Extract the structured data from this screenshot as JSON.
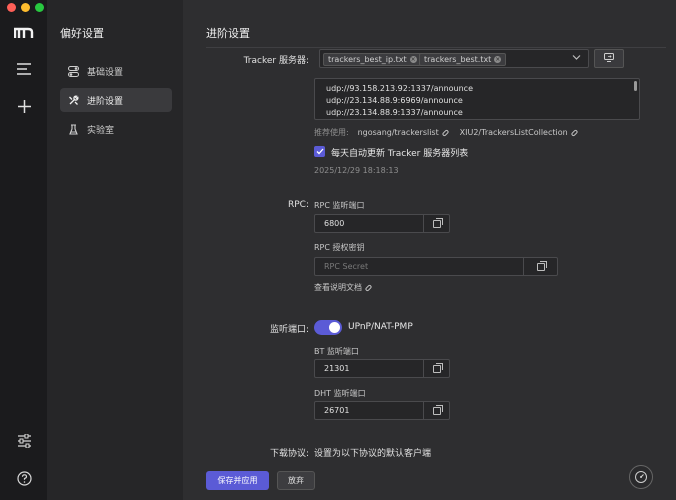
{
  "colors": {
    "accent": "#5b5bd6",
    "rail_bg": "#1b1b1d",
    "sidebar_bg": "#262628",
    "main_bg": "#2e2e30"
  },
  "rail": {
    "logo_icon": "m-logo-icon",
    "top_icons": [
      "menu-lines-icon",
      "plus-icon"
    ],
    "bottom_icons": [
      "sliders-icon",
      "help-circle-icon"
    ]
  },
  "sidebar": {
    "title": "偏好设置",
    "items": [
      {
        "label": "基础设置",
        "icon": "toggle-icon",
        "active": false
      },
      {
        "label": "进阶设置",
        "icon": "wrench-icon",
        "active": true
      },
      {
        "label": "实验室",
        "icon": "flask-icon",
        "active": false
      }
    ]
  },
  "main": {
    "title": "进阶设置",
    "tracker": {
      "label": "Tracker 服务器:",
      "selected": [
        "trackers_best_ip.txt",
        "trackers_best.txt"
      ],
      "lines": [
        "udp://93.158.213.92:1337/announce",
        "udp://23.134.88.9:6969/announce",
        "udp://23.134.88.9:1337/announce"
      ],
      "recommend_label": "推荐使用:",
      "links": [
        "ngosang/trackerslist",
        "XIU2/TrackersListCollection"
      ],
      "auto_update_label": "每天自动更新 Tracker 服务器列表",
      "auto_update_checked": true,
      "last_update": "2025/12/29 18:18:13"
    },
    "rpc": {
      "label": "RPC:",
      "port_label": "RPC 监听端口",
      "port_value": "6800",
      "secret_label": "RPC 授权密钥",
      "secret_placeholder": "RPC Secret",
      "docs_link": "查看说明文档"
    },
    "listen": {
      "label": "监听端口:",
      "upnp_label": "UPnP/NAT-PMP",
      "upnp_on": true,
      "bt_label": "BT 监听端口",
      "bt_value": "21301",
      "dht_label": "DHT 监听端口",
      "dht_value": "26701"
    },
    "protocol": {
      "label": "下载协议:",
      "desc": "设置为以下协议的默认客户端"
    },
    "buttons": {
      "save": "保存并应用",
      "discard": "放弃"
    }
  }
}
